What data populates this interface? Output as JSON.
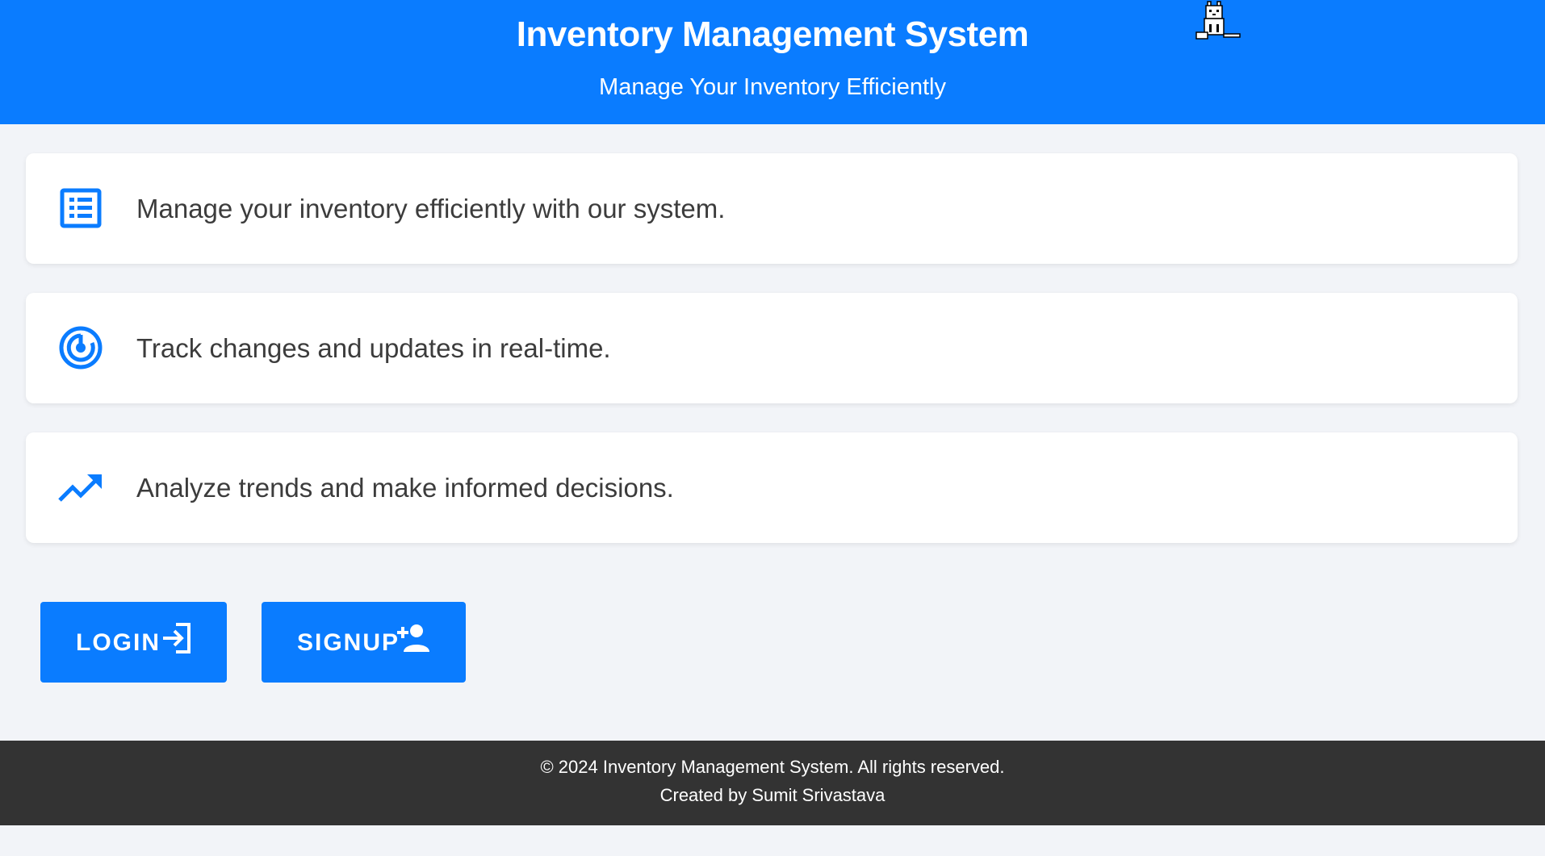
{
  "header": {
    "title": "Inventory Management System",
    "subtitle": "Manage Your Inventory Efficiently"
  },
  "features": [
    {
      "icon": "list-icon",
      "text": "Manage your inventory efficiently with our system."
    },
    {
      "icon": "radar-icon",
      "text": "Track changes and updates in real-time."
    },
    {
      "icon": "trending-up-icon",
      "text": "Analyze trends and make informed decisions."
    }
  ],
  "actions": {
    "login_label": "LOGIN",
    "login_icon": "login-icon",
    "signup_label": "SIGNUP",
    "signup_icon": "person-add-icon"
  },
  "footer": {
    "copyright": "© 2024 Inventory Management System. All rights reserved.",
    "credit": "Created by Sumit Srivastava"
  },
  "colors": {
    "primary": "#0a7cff",
    "background": "#f2f4f8",
    "footer": "#333333",
    "text": "#3c3c3c"
  }
}
